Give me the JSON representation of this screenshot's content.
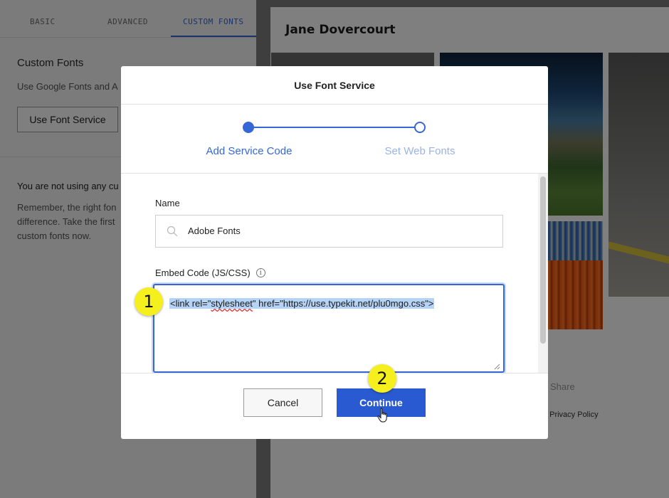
{
  "background": {
    "tabs": [
      {
        "label": "BASIC"
      },
      {
        "label": "ADVANCED"
      },
      {
        "label": "CUSTOM FONTS"
      }
    ],
    "custom_fonts_title": "Custom Fonts",
    "custom_fonts_desc": "Use Google Fonts and A",
    "use_font_service_label": "Use Font Service",
    "warning_text": "You are not using any cu",
    "remember_text": "Remember, the right fon\ndifference. Take the first\ncustom fonts now.",
    "author_name": "Jane Dovercourt",
    "share_label": "Share",
    "privacy_label": ". Privacy Policy"
  },
  "modal": {
    "title": "Use Font Service",
    "steps": [
      {
        "label": "Add Service Code",
        "state": "active"
      },
      {
        "label": "Set Web Fonts",
        "state": "inactive"
      }
    ],
    "name_label": "Name",
    "name_value": "Adobe Fonts",
    "embed_label": "Embed Code (JS/CSS)",
    "info_glyph": "i",
    "embed_code_parts": {
      "before": "<link rel=\"",
      "misspelled": "stylesheet",
      "after": "\" href=\"https://use.typekit.net/plu0mgo.css\">"
    },
    "cancel_label": "Cancel",
    "continue_label": "Continue"
  },
  "annotations": [
    {
      "label": "1"
    },
    {
      "label": "2"
    }
  ],
  "colors": {
    "accent": "#3667d6",
    "button_primary": "#2a5ad1",
    "annotation_badge": "#f5ef1d",
    "selection": "#b5d3f5"
  },
  "icons": [
    "search-icon",
    "info-icon",
    "resize-handle-icon",
    "hand-cursor-icon"
  ]
}
